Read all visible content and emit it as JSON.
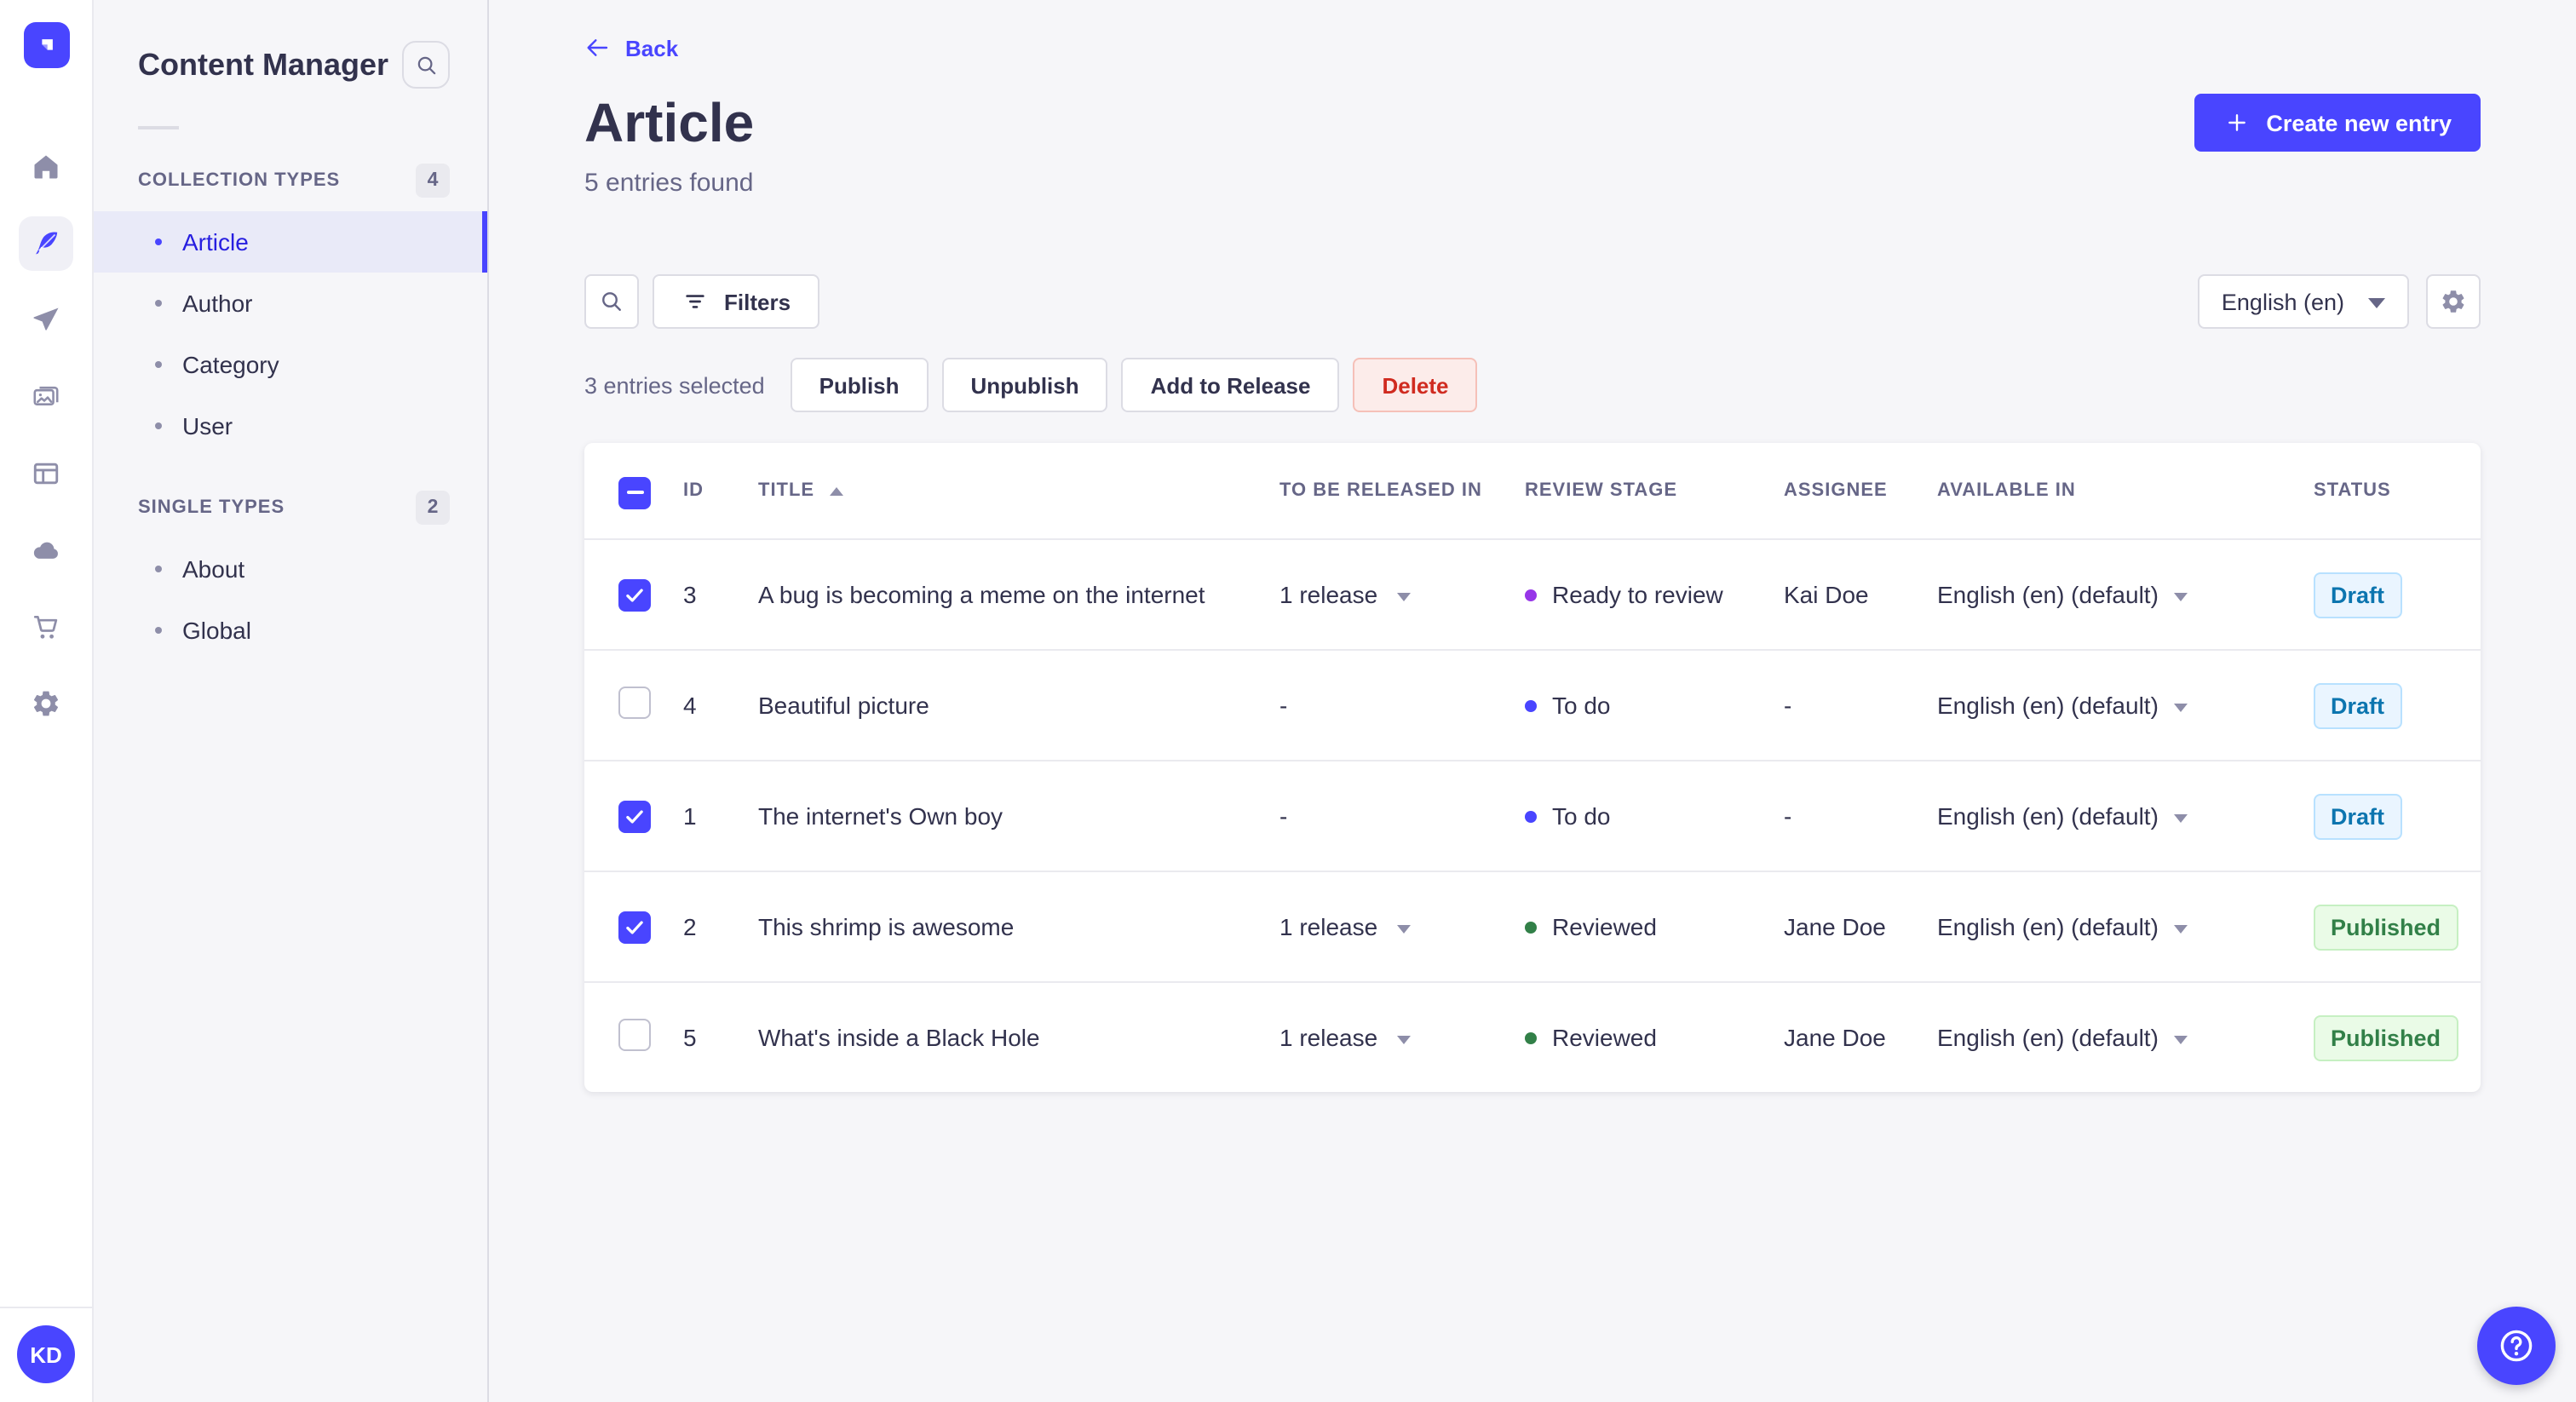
{
  "colors": {
    "primary": "#4945FF",
    "active_link_text": "#271FE0",
    "stage_ready_to_review": "#9736E8",
    "stage_to_do": "#4945FF",
    "stage_reviewed": "#328048",
    "status_draft_text": "#0C75AF",
    "status_draft_bg": "#EAF5FF",
    "status_published_text": "#328048",
    "status_published_bg": "#EAFBE7",
    "delete_text": "#D02B20",
    "delete_bg": "#FCECEA"
  },
  "rail": {
    "icons": [
      "home-icon",
      "content-manager-icon",
      "releases-icon",
      "media-library-icon",
      "content-type-builder-icon",
      "deploy-icon",
      "marketplace-icon",
      "settings-icon"
    ],
    "avatar_initials": "KD"
  },
  "sidebar": {
    "title": "Content Manager",
    "sections": [
      {
        "label": "COLLECTION TYPES",
        "badge": "4",
        "items": [
          {
            "label": "Article"
          },
          {
            "label": "Author"
          },
          {
            "label": "Category"
          },
          {
            "label": "User"
          }
        ]
      },
      {
        "label": "SINGLE TYPES",
        "badge": "2",
        "items": [
          {
            "label": "About"
          },
          {
            "label": "Global"
          }
        ]
      }
    ]
  },
  "header": {
    "back_label": "Back",
    "title": "Article",
    "subtitle": "5 entries found",
    "create_button": "Create new entry"
  },
  "toolbar": {
    "filters_label": "Filters",
    "locale_value": "English (en)"
  },
  "selection_bar": {
    "selected_text": "3 entries selected",
    "publish_label": "Publish",
    "unpublish_label": "Unpublish",
    "add_to_release_label": "Add to Release",
    "delete_label": "Delete"
  },
  "table": {
    "headers": {
      "id": "ID",
      "title": "TITLE",
      "release": "TO BE RELEASED IN",
      "stage": "REVIEW STAGE",
      "assignee": "ASSIGNEE",
      "available": "AVAILABLE IN",
      "status": "STATUS"
    },
    "rows": [
      {
        "checked": true,
        "id": "3",
        "title": "A bug is becoming a meme on the internet",
        "release": "1 release",
        "stage": "Ready to review",
        "assignee": "Kai Doe",
        "available": "English (en) (default)",
        "status": "Draft"
      },
      {
        "checked": false,
        "id": "4",
        "title": "Beautiful picture",
        "release": "-",
        "stage": "To do",
        "assignee": "-",
        "available": "English (en) (default)",
        "status": "Draft"
      },
      {
        "checked": true,
        "id": "1",
        "title": "The internet's Own boy",
        "release": "-",
        "stage": "To do",
        "assignee": "-",
        "available": "English (en) (default)",
        "status": "Draft"
      },
      {
        "checked": true,
        "id": "2",
        "title": "This shrimp is awesome",
        "release": "1 release",
        "stage": "Reviewed",
        "assignee": "Jane Doe",
        "available": "English (en) (default)",
        "status": "Published"
      },
      {
        "checked": false,
        "id": "5",
        "title": "What's inside a Black Hole",
        "release": "1 release",
        "stage": "Reviewed",
        "assignee": "Jane Doe",
        "available": "English (en) (default)",
        "status": "Published"
      }
    ]
  }
}
